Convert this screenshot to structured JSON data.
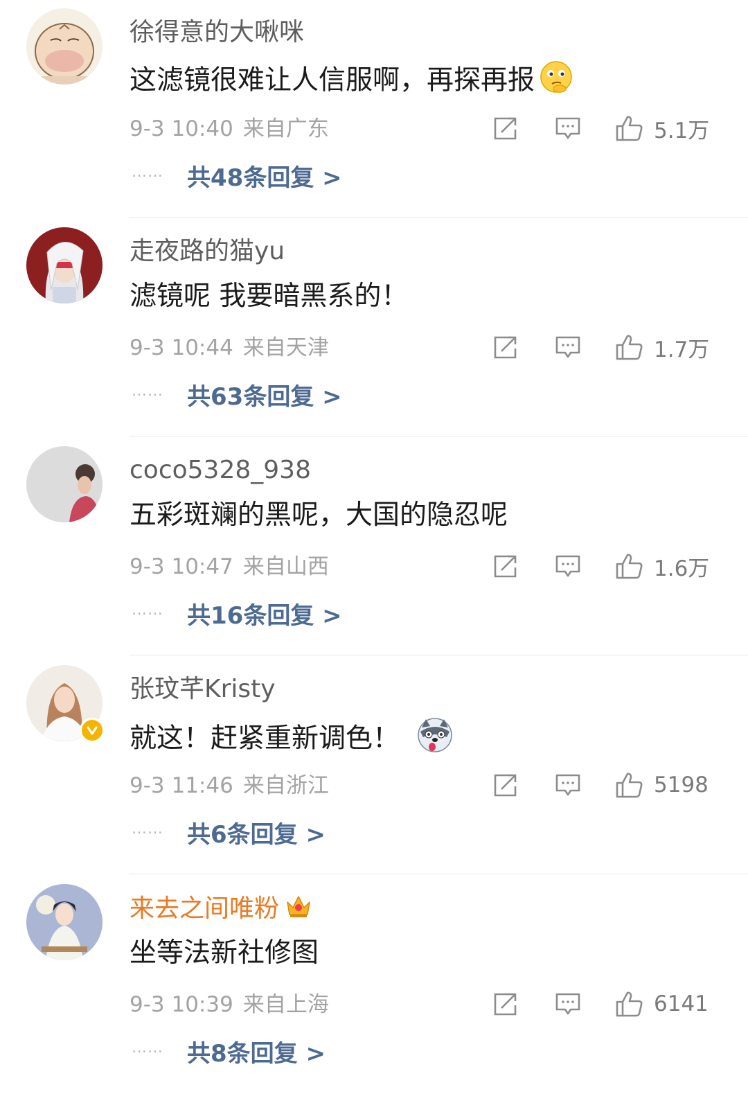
{
  "comments": [
    {
      "username": "徐得意的大啾咪",
      "text": "这滤镜很难让人信服啊，再探再报",
      "time": "9-3 10:40",
      "location": "来自广东",
      "likes": "5.1万",
      "replies": "共48条回复 >",
      "emoji": "thinking-emoji"
    },
    {
      "username": "走夜路的猫yu",
      "text": "滤镜呢  我要暗黑系的！",
      "time": "9-3 10:44",
      "location": "来自天津",
      "likes": "1.7万",
      "replies": "共63条回复 >"
    },
    {
      "username": "coco5328_938",
      "text": "五彩斑斓的黑呢，大国的隐忍呢",
      "time": "9-3 10:47",
      "location": "来自山西",
      "likes": "1.6万",
      "replies": "共16条回复 >"
    },
    {
      "username": "张玟芊Kristy",
      "text": "就这！赶紧重新调色！",
      "time": "9-3 11:46",
      "location": "来自浙江",
      "likes": "5198",
      "replies": "共6条回复 >",
      "emoji": "husky-emoji",
      "verified": true
    },
    {
      "username": "来去之间唯粉",
      "text": "坐等法新社修图",
      "time": "9-3 10:39",
      "location": "来自上海",
      "likes": "6141",
      "replies": "共8条回复 >",
      "vip": true
    }
  ],
  "dots": "……",
  "colors": {
    "link": "#4d6a91",
    "vip_name": "#ea7a23",
    "meta": "#a3a3a3",
    "badge": "#f5b400"
  },
  "icons": {
    "share": "share-icon",
    "reply": "comment-icon",
    "like": "thumbs-up-icon",
    "verified": "verified-badge-icon",
    "crown": "fan-crown-icon"
  }
}
